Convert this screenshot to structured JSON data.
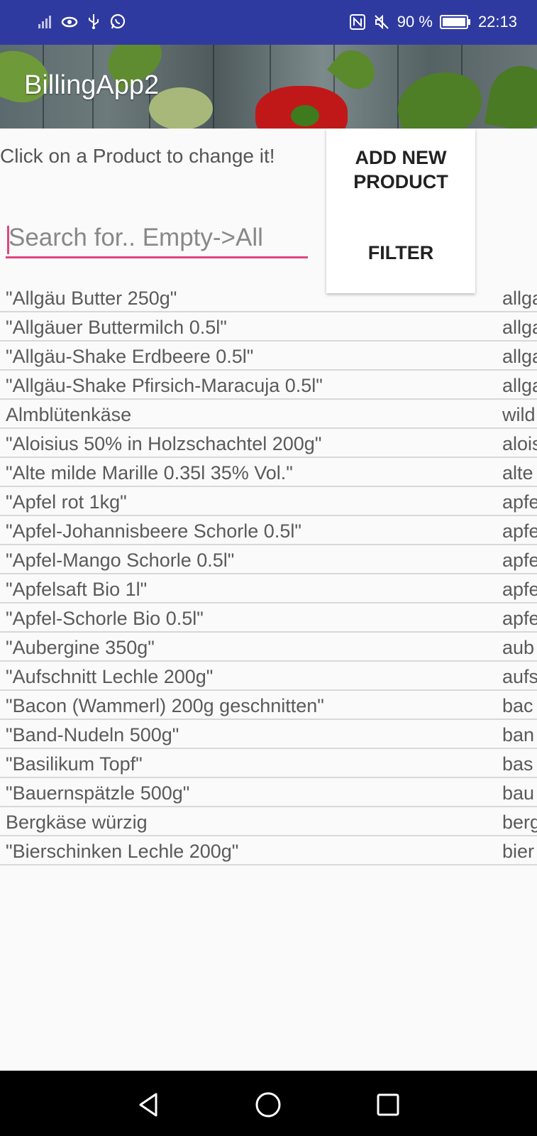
{
  "status_bar": {
    "battery": "90 %",
    "time": "22:13",
    "icons_left": [
      "signal-icon",
      "eye-icon",
      "usb-icon",
      "whatsapp-icon"
    ],
    "icons_right": [
      "nfc-icon",
      "mute-icon",
      "battery-icon"
    ]
  },
  "header": {
    "title": "BillingApp2"
  },
  "hint": "Click on a Product to change it!",
  "search": {
    "placeholder": "Search for.. Empty->All",
    "value": ""
  },
  "buttons": {
    "add_new_line1": "ADD NEW",
    "add_new_line2": "PRODUCT",
    "filter": "FILTER"
  },
  "products": [
    {
      "name": "\"Allgäu Butter 250g\"",
      "key": "allga"
    },
    {
      "name": "\"Allgäuer Buttermilch 0.5l\"",
      "key": "allga"
    },
    {
      "name": "\"Allgäu-Shake Erdbeere 0.5l\"",
      "key": "allga"
    },
    {
      "name": "\"Allgäu-Shake Pfirsich-Maracuja 0.5l\"",
      "key": "allga"
    },
    {
      "name": "Almblütenkäse",
      "key": "wild"
    },
    {
      "name": "\"Aloisius 50% in Holzschachtel 200g\"",
      "key": "alois"
    },
    {
      "name": "\"Alte milde Marille 0.35l 35% Vol.\"",
      "key": "alte"
    },
    {
      "name": "\"Apfel rot 1kg\"",
      "key": "apfe"
    },
    {
      "name": "\"Apfel-Johannisbeere Schorle 0.5l\"",
      "key": "apfe"
    },
    {
      "name": "\"Apfel-Mango Schorle 0.5l\"",
      "key": "apfe"
    },
    {
      "name": "\"Apfelsaft Bio 1l\"",
      "key": "apfe"
    },
    {
      "name": "\"Apfel-Schorle Bio 0.5l\"",
      "key": "apfe"
    },
    {
      "name": "\"Aubergine 350g\"",
      "key": "aub"
    },
    {
      "name": "\"Aufschnitt Lechle 200g\"",
      "key": "aufs"
    },
    {
      "name": "\"Bacon (Wammerl) 200g geschnitten\"",
      "key": "bac"
    },
    {
      "name": "\"Band-Nudeln 500g\"",
      "key": "ban"
    },
    {
      "name": "\"Basilikum Topf\"",
      "key": "bas"
    },
    {
      "name": "\"Bauernspätzle 500g\"",
      "key": "bau"
    },
    {
      "name": "Bergkäse würzig",
      "key": "berg"
    },
    {
      "name": "\"Bierschinken Lechle 200g\"",
      "key": "bier"
    }
  ],
  "nav": [
    "back-icon",
    "home-icon",
    "recents-icon"
  ],
  "colors": {
    "status_bar": "#2f3aa0",
    "accent": "#e0457e",
    "nav_bar": "#000000"
  }
}
